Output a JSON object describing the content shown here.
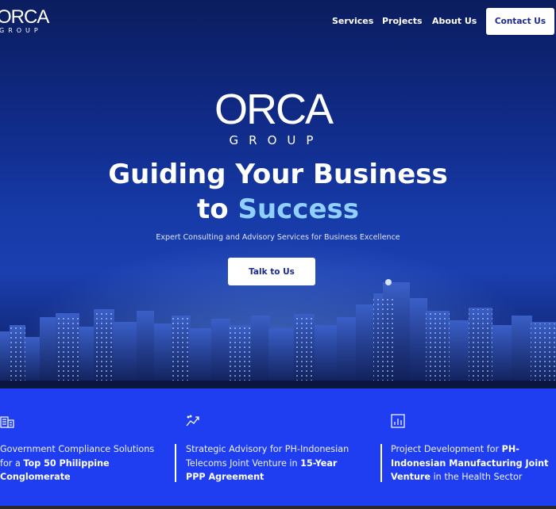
{
  "nav": {
    "logo_word": "ORCA",
    "logo_sub": "GROUP",
    "links": [
      "Services",
      "Projects",
      "About Us"
    ],
    "contact_label": "Contact Us"
  },
  "hero": {
    "logo_word": "ORCA",
    "logo_sub": "GROUP",
    "headline_line1": "Guiding Your Business",
    "headline_to": "to ",
    "headline_accent": "Success",
    "tagline": "Expert Consulting and Advisory Services for Business Excellence",
    "cta_label": "Talk to Us"
  },
  "stats": [
    {
      "icon": "building-icon",
      "pre": "Government Compliance Solutions for a ",
      "bold": "Top 50 Philippine Conglomerate",
      "post": ""
    },
    {
      "icon": "trend-chart-icon",
      "pre": "Strategic Advisory for PH-Indonesian Telecoms Joint Venture in ",
      "bold": "15-Year PPP Agreement",
      "post": ""
    },
    {
      "icon": "bar-chart-icon",
      "pre": "Project Development for ",
      "bold": "PH-Indonesian Manufacturing Joint Venture",
      "post": " in the Health Sector"
    }
  ],
  "colors": {
    "hero_top": "#0b1d5e",
    "accent_text": "#8fd0ff",
    "band_blue": "#1f3ef2",
    "button_text": "#1c2a8c"
  }
}
